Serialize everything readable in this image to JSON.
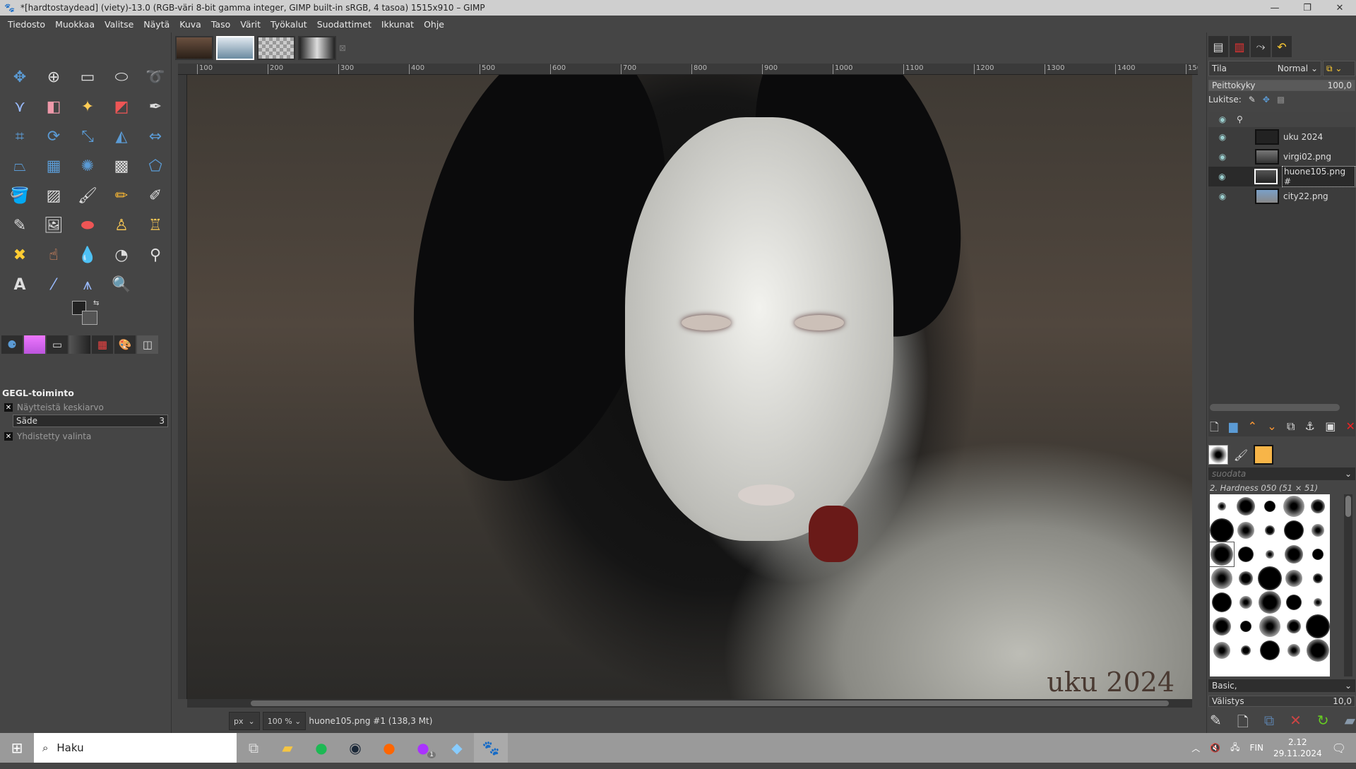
{
  "window": {
    "title": "*[hardtostaydead] (viety)-13.0 (RGB-väri 8-bit gamma integer, GIMP built-in sRGB, 4 tasoa) 1515x910 – GIMP"
  },
  "menu": [
    "Tiedosto",
    "Muokkaa",
    "Valitse",
    "Näytä",
    "Kuva",
    "Taso",
    "Värit",
    "Työkalut",
    "Suodattimet",
    "Ikkunat",
    "Ohje"
  ],
  "tool_options": {
    "title": "GEGL-toiminto",
    "sample_average": "Näytteistä keskiarvo",
    "radius_label": "Säde",
    "radius_value": "3",
    "merged": "Yhdistetty valinta"
  },
  "ruler": [
    100,
    200,
    300,
    400,
    500,
    600,
    700,
    800,
    900,
    1000,
    1100,
    1200,
    1300,
    1400,
    1500
  ],
  "canvas": {
    "watermark": "uku 2024"
  },
  "status": {
    "unit": "px",
    "zoom": "100 %",
    "info": "huone105.png #1 (138,3 Mt)"
  },
  "layers": {
    "mode_label": "Tila",
    "mode": "Normal",
    "opacity_label": "Peittokyky",
    "opacity": "100,0",
    "lock_label": "Lukitse:",
    "items": [
      {
        "name": "uku 2024",
        "visible": true
      },
      {
        "name": "virgi02.png",
        "visible": true
      },
      {
        "name": "huone105.png #",
        "visible": true,
        "selected": true
      },
      {
        "name": "city22.png",
        "visible": true
      }
    ]
  },
  "brushes": {
    "filter_placeholder": "suodata",
    "current": "2. Hardness 050 (51 × 51)",
    "tag": "Basic,",
    "spacing_label": "Välistys",
    "spacing": "10,0"
  },
  "taskbar": {
    "search": "Haku",
    "lang": "FIN",
    "time": "2.12",
    "date": "29.11.2024",
    "messenger_badge": "1"
  }
}
